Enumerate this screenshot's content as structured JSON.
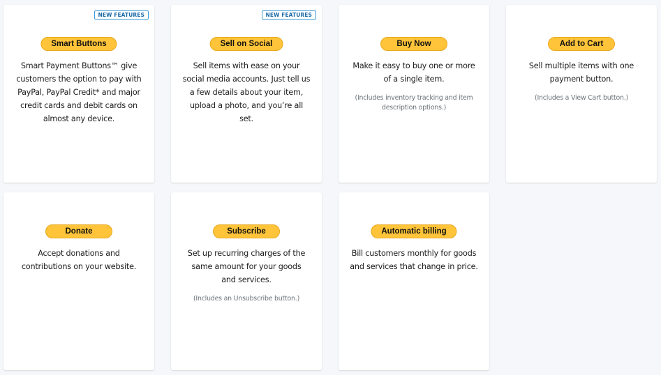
{
  "cards": [
    {
      "badge": "NEW FEATURES",
      "button_label": "Smart Buttons",
      "description": "Smart Payment Buttons™ give customers the option to pay with PayPal, PayPal Credit* and major credit cards and debit cards on almost any device.",
      "note": null
    },
    {
      "badge": "NEW FEATURES",
      "button_label": "Sell on Social",
      "description": "Sell items with ease on your social media accounts. Just tell us a few details about your item, upload a photo, and you’re all set.",
      "note": null
    },
    {
      "badge": null,
      "button_label": "Buy Now",
      "description": "Make it easy to buy one or more of a single item.",
      "note": "(Includes inventory tracking and item description options.)"
    },
    {
      "badge": null,
      "button_label": "Add to Cart",
      "description": "Sell multiple items with one payment button.",
      "note": "(Includes a View Cart button.)"
    },
    {
      "badge": null,
      "button_label": "Donate",
      "description": "Accept donations and contributions on your website.",
      "note": null
    },
    {
      "badge": null,
      "button_label": "Subscribe",
      "description": "Set up recurring charges of the same amount for your goods and services.",
      "note": "(Includes an Unsubscribe button.)"
    },
    {
      "badge": null,
      "button_label": "Automatic billing",
      "description": "Bill customers monthly for goods and services that change in price.",
      "note": null
    }
  ],
  "colors": {
    "button_fill": "#ffc439",
    "badge_text": "#1a6aa8",
    "page_background": "#f5f7fa"
  }
}
